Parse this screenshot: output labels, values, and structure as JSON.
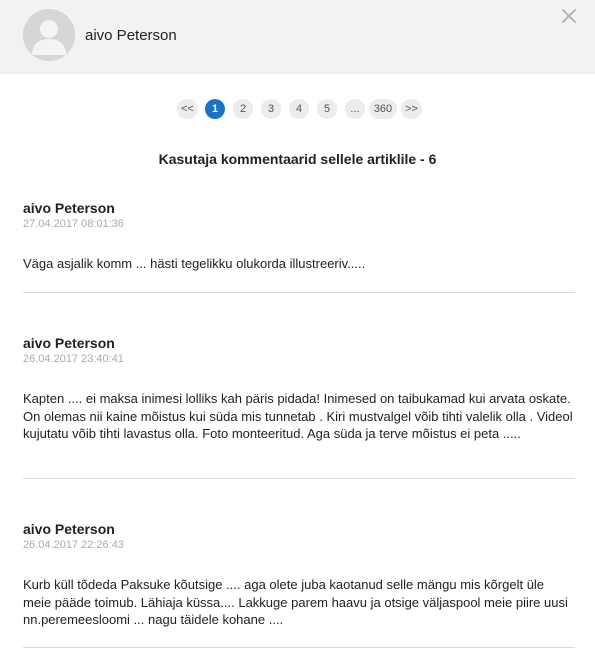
{
  "header": {
    "user_name": "aivo Peterson",
    "avatar_icon": "user-silhouette-icon",
    "close_icon": "close-icon"
  },
  "pagination": {
    "prev_label": "<<",
    "pages": [
      "1",
      "2",
      "3",
      "4",
      "5"
    ],
    "current_page": "1",
    "ellipsis": "...",
    "last_page": "360",
    "next_label": ">>",
    "accent_color": "#1a73c9"
  },
  "section_title": "Kasutaja kommentaarid sellele artiklile - 6",
  "comments": [
    {
      "author": "aivo Peterson",
      "date": "27.04.2017 08:01:36",
      "text": "Väga asjalik komm ... hästi tegelikku olukorda illustreeriv....."
    },
    {
      "author": "aivo Peterson",
      "date": "26.04.2017 23:40:41",
      "text": "Kapten .... ei maksa inimesi lolliks kah päris pidada! Inimesed on taibukamad kui arvata oskate. On olemas nii kaine mõistus kui süda mis tunnetab . Kiri mustvalgel võib tihti valelik olla . Videol kujutatu võib tihti lavastus olla. Foto monteeritud. Aga süda ja terve mõistus ei peta ....."
    },
    {
      "author": "aivo Peterson",
      "date": "26.04.2017 22:26:43",
      "text": "Kurb küll tõdeda Paksuke kõutsige .... aga olete juba kaotanud selle mängu mis kõrgelt üle meie pääde toimub. Lähiaja küssa.... Lakkuge parem haavu ja otsige väljaspool meie piire uusi nn.peremeesloomi ... nagu täidele kohane ...."
    }
  ]
}
